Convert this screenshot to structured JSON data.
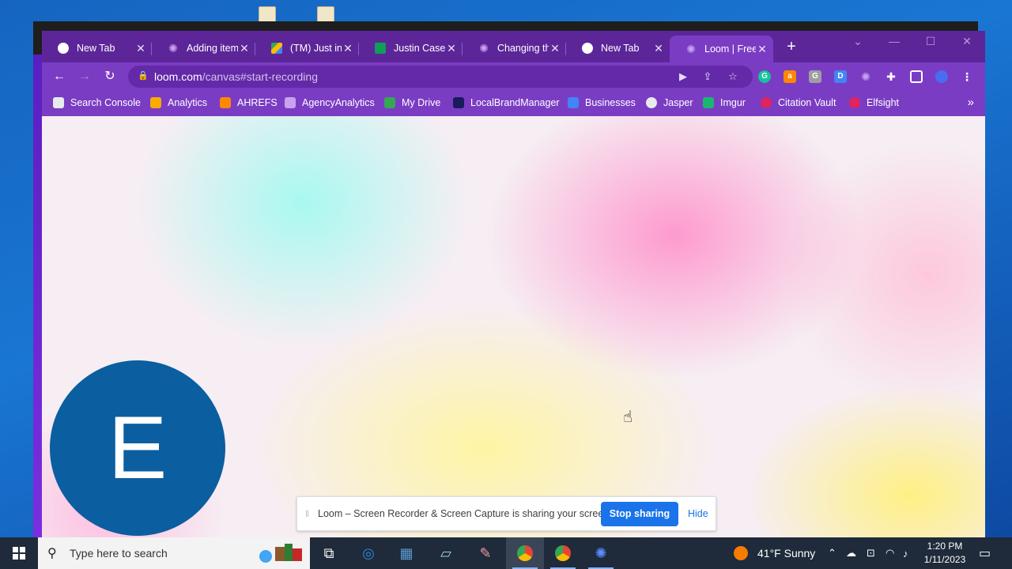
{
  "browser": {
    "tabs": [
      {
        "title": "New Tab",
        "icon": "chrome-icon",
        "active": false
      },
      {
        "title": "Adding item",
        "icon": "jasper-icon",
        "active": false
      },
      {
        "title": "(TM) Just in C",
        "icon": "google-drive-icon",
        "active": false
      },
      {
        "title": "Justin Case R",
        "icon": "google-sheets-icon",
        "active": false
      },
      {
        "title": "Changing th",
        "icon": "jasper-icon",
        "active": false
      },
      {
        "title": "New Tab",
        "icon": "chrome-icon",
        "active": false
      },
      {
        "title": "Loom | Free",
        "icon": "loom-icon",
        "active": true
      }
    ],
    "address": {
      "host": "loom.com",
      "path": "/canvas#start-recording"
    },
    "bookmarks": [
      {
        "label": "Search Console",
        "icon": "search-console-icon",
        "color": "#e8eaed"
      },
      {
        "label": "Analytics",
        "icon": "analytics-icon",
        "color": "#f9ab00"
      },
      {
        "label": "AHREFS",
        "icon": "ahrefs-icon",
        "color": "#ff8800"
      },
      {
        "label": "AgencyAnalytics",
        "icon": "agencyanalytics-icon",
        "color": "#c8a2f0"
      },
      {
        "label": "My Drive",
        "icon": "google-drive-icon",
        "color": "#34a853"
      },
      {
        "label": "LocalBrandManager",
        "icon": "lbm-icon",
        "color": "#1a1a5e"
      },
      {
        "label": "Businesses",
        "icon": "businesses-icon",
        "color": "#4285f4"
      },
      {
        "label": "Jasper",
        "icon": "jasper-icon",
        "color": "#e8eaed"
      },
      {
        "label": "Imgur",
        "icon": "imgur-icon",
        "color": "#1bb76e"
      },
      {
        "label": "Citation Vault",
        "icon": "citation-vault-icon",
        "color": "#e0245e"
      },
      {
        "label": "Elfsight",
        "icon": "elfsight-icon",
        "color": "#e0245e"
      }
    ]
  },
  "page": {
    "avatar_letter": "E"
  },
  "share_bar": {
    "message": "Loom – Screen Recorder & Screen Capture is sharing your screen.",
    "stop_label": "Stop sharing",
    "hide_label": "Hide"
  },
  "taskbar": {
    "search_placeholder": "Type here to search",
    "weather": "41°F  Sunny",
    "time": "1:20 PM",
    "date": "1/11/2023"
  },
  "colors": {
    "browser_frame": "#5c2699",
    "toolbar": "#7b3cc4",
    "avatar": "#0b5e9f",
    "stop_button": "#1a73e8"
  }
}
